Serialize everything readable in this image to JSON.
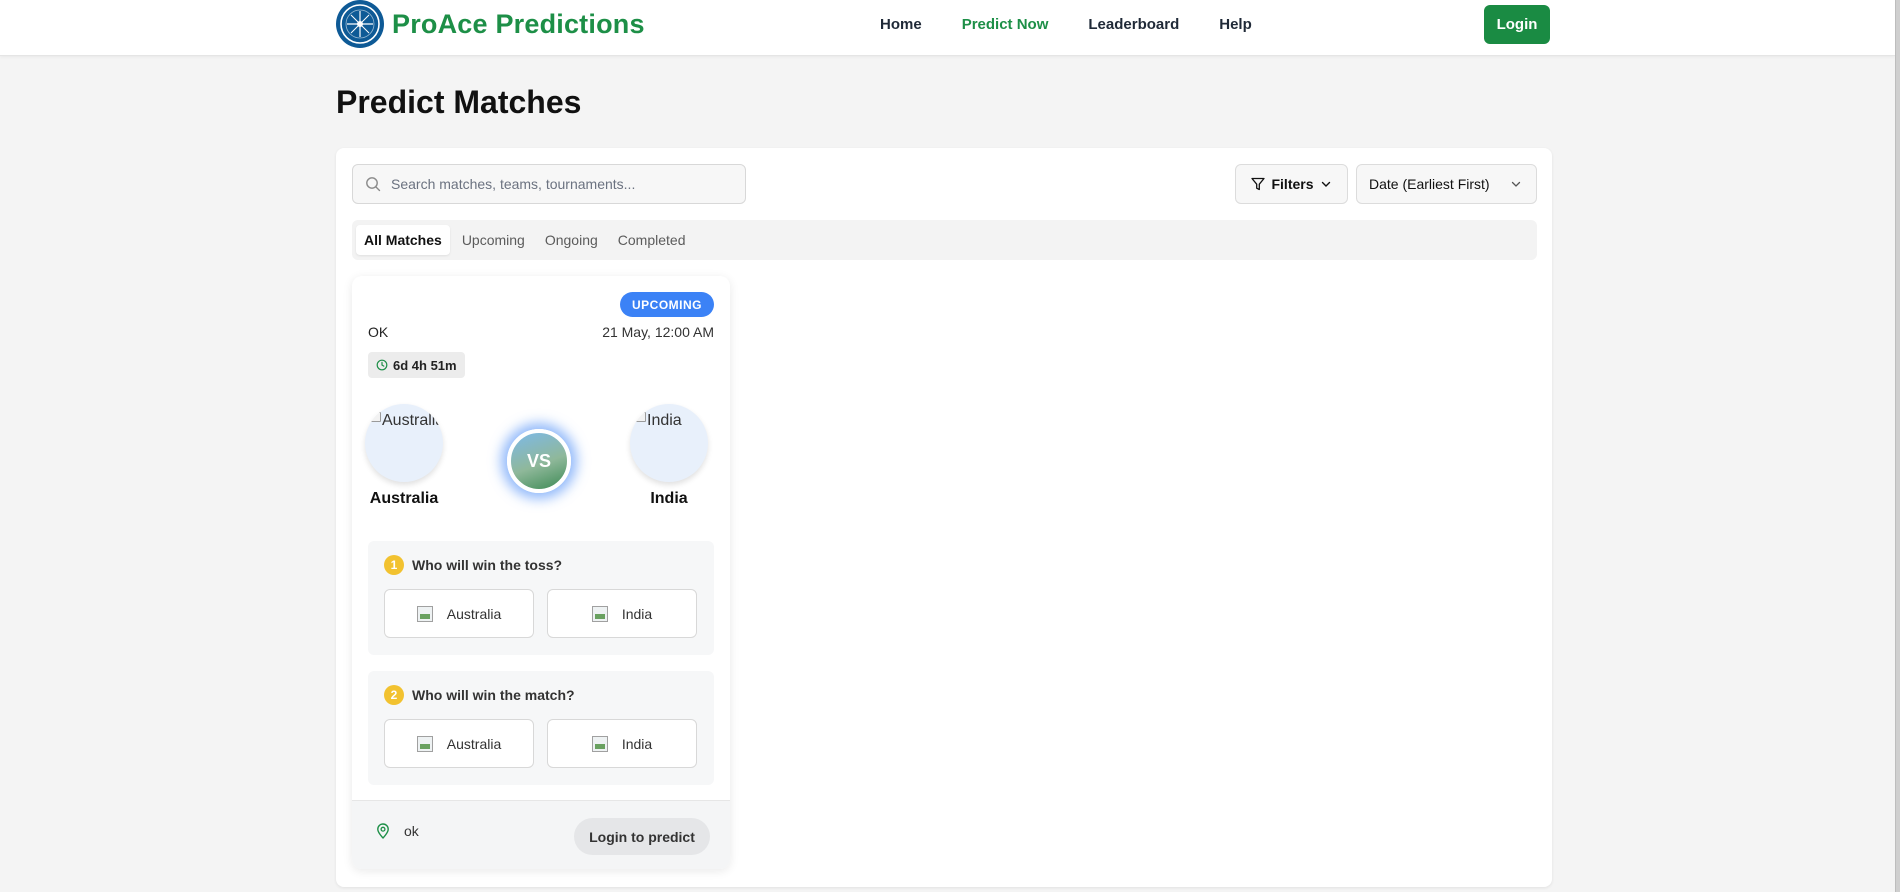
{
  "header": {
    "brand": "ProAce Predictions",
    "nav": [
      {
        "label": "Home",
        "active": false
      },
      {
        "label": "Predict Now",
        "active": true
      },
      {
        "label": "Leaderboard",
        "active": false
      },
      {
        "label": "Help",
        "active": false
      }
    ],
    "login_label": "Login"
  },
  "page": {
    "title": "Predict Matches"
  },
  "toolbar": {
    "search_placeholder": "Search matches, teams, tournaments...",
    "filters_label": "Filters",
    "sort_value": "Date (Earliest First)"
  },
  "tabs": [
    {
      "label": "All Matches",
      "active": true
    },
    {
      "label": "Upcoming",
      "active": false
    },
    {
      "label": "Ongoing",
      "active": false
    },
    {
      "label": "Completed",
      "active": false
    }
  ],
  "match": {
    "status": "UPCOMING",
    "title": "OK",
    "date": "21 May, 12:00 AM",
    "countdown": "6d 4h 51m",
    "team_a": {
      "name": "Australia",
      "logo_alt": "Australia"
    },
    "team_b": {
      "name": "India",
      "logo_alt": "India"
    },
    "vs_label": "VS",
    "questions": [
      {
        "number": "1",
        "text": "Who will win the toss?",
        "options": [
          "Australia",
          "India"
        ]
      },
      {
        "number": "2",
        "text": "Who will win the match?",
        "options": [
          "Australia",
          "India"
        ]
      }
    ],
    "venue": "ok",
    "predict_label": "Login to predict"
  },
  "colors": {
    "brand_green": "#1d8f47",
    "logo_blue": "#0e5a96",
    "status_blue": "#3b82f6",
    "question_badge": "#f2c230"
  },
  "icons": {
    "logo": "compass-icon",
    "search": "search-icon",
    "filter": "funnel-icon",
    "chevron": "chevron-down-icon",
    "clock": "clock-icon",
    "venue": "map-pin-icon"
  }
}
